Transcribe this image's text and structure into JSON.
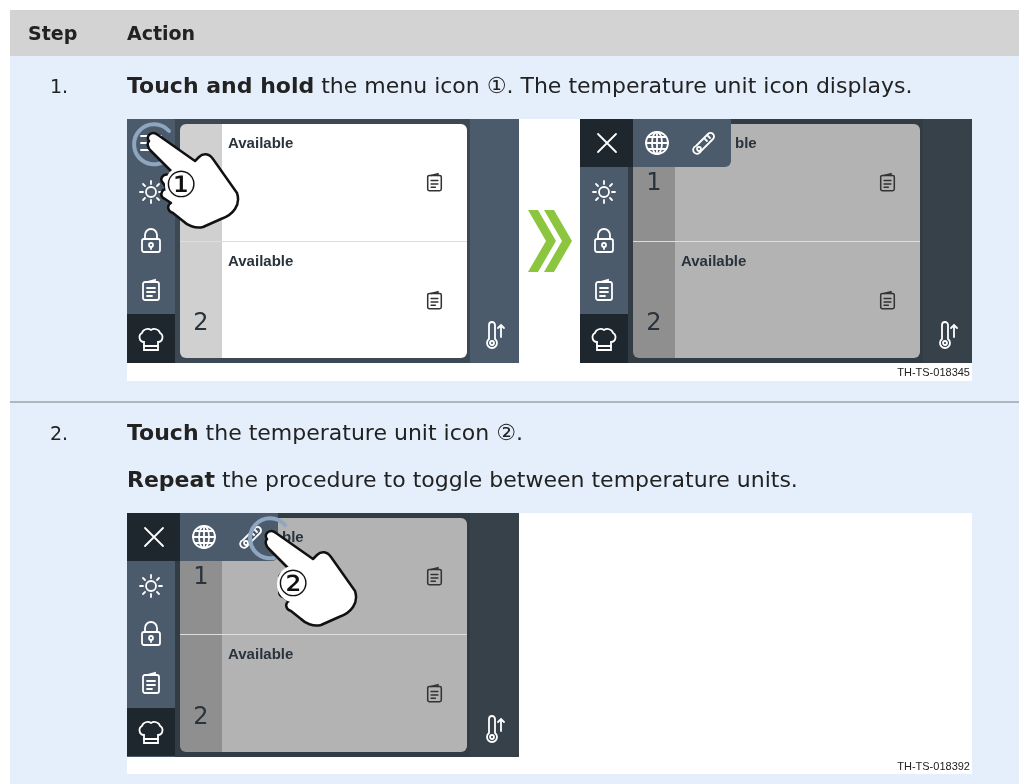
{
  "table": {
    "columns": [
      "Step",
      "Action"
    ],
    "rows": [
      {
        "step": "1.",
        "paragraphs": [
          "**Touch and hold** the menu icon ①. The temperature unit icon displays."
        ],
        "figure": {
          "screens": [
            {
              "menu_open": false,
              "dimmed": false,
              "rows": [
                {
                  "status": "Available"
                },
                {
                  "number": "2",
                  "status": "Available"
                }
              ],
              "callout": {
                "label": "①",
                "kind": "menu"
              }
            },
            {
              "menu_open": true,
              "dimmed": true,
              "rows": [
                {
                  "number": "1",
                  "status": "ble"
                },
                {
                  "number": "2",
                  "status": "Available"
                }
              ]
            }
          ],
          "arrow": true,
          "figure_id": "TH-TS-018345"
        }
      },
      {
        "step": "2.",
        "paragraphs": [
          "**Touch** the temperature unit icon ②.",
          "**Repeat** the procedure to toggle between temperature units."
        ],
        "figure": {
          "screens": [
            {
              "menu_open": true,
              "dimmed": true,
              "rows": [
                {
                  "number": "1",
                  "status": "ble"
                },
                {
                  "number": "2",
                  "status": "Available"
                }
              ],
              "callout": {
                "label": "②",
                "kind": "temperature"
              }
            }
          ],
          "arrow": false,
          "figure_id": "TH-TS-018392"
        }
      }
    ]
  }
}
